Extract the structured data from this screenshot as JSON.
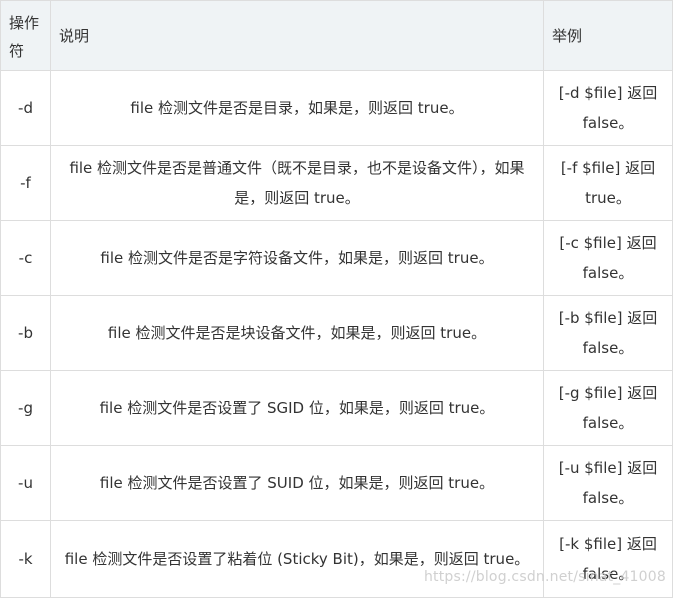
{
  "table": {
    "headers": {
      "operator": "操作符",
      "description": "说明",
      "example": "举例"
    },
    "rows": [
      {
        "operator": "-d",
        "description": "file 检测文件是否是目录，如果是，则返回 true。",
        "example": "[-d $file] 返回 false。"
      },
      {
        "operator": "-f",
        "description": "file 检测文件是否是普通文件（既不是目录，也不是设备文件），如果是，则返回 true。",
        "example": "[-f $file] 返回 true。"
      },
      {
        "operator": "-c",
        "description": "file 检测文件是否是字符设备文件，如果是，则返回 true。",
        "example": "[-c $file] 返回 false。"
      },
      {
        "operator": "-b",
        "description": "file 检测文件是否是块设备文件，如果是，则返回 true。",
        "example": "[-b $file] 返回 false。"
      },
      {
        "operator": "-g",
        "description": "file 检测文件是否设置了 SGID 位，如果是，则返回 true。",
        "example": "[-g $file] 返回 false。"
      },
      {
        "operator": "-u",
        "description": "file 检测文件是否设置了 SUID 位，如果是，则返回 true。",
        "example": "[-u $file] 返回 false。"
      },
      {
        "operator": "-k",
        "description": "file 检测文件是否设置了粘着位 (Sticky Bit)，如果是，则返回 true。",
        "example": "[-k $file] 返回 false。"
      }
    ]
  },
  "watermark": "https://blog.csdn.net/sinat_41008",
  "colors": {
    "header_bg": "#eff3f5",
    "border": "#dddddd",
    "text": "#333333"
  }
}
